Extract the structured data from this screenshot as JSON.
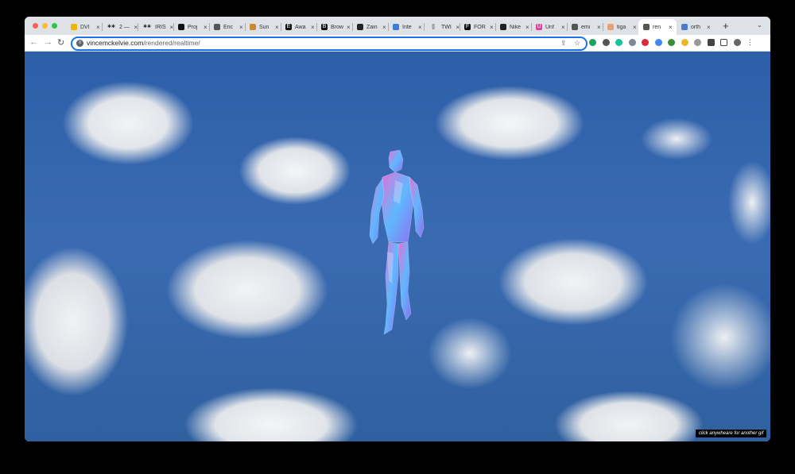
{
  "tabs": [
    {
      "title": "DVI",
      "icon": "yellow-badge-icon",
      "color": "#f2b400",
      "glyph": ""
    },
    {
      "title": "2 —",
      "icon": "dots-icon",
      "color": "#333333",
      "glyph": "✱✱"
    },
    {
      "title": "IRIS",
      "icon": "dots-icon",
      "color": "#333333",
      "glyph": "✱✱"
    },
    {
      "title": "Proj",
      "icon": "black-circle-icon",
      "color": "#111111",
      "glyph": ""
    },
    {
      "title": "Eric",
      "icon": "globe-icon",
      "color": "#555555",
      "glyph": ""
    },
    {
      "title": "Sun",
      "icon": "chair-icon",
      "color": "#c98a2b",
      "glyph": ""
    },
    {
      "title": "Awa",
      "icon": "e-square-icon",
      "color": "#111111",
      "glyph": "E"
    },
    {
      "title": "Brow",
      "icon": "b-square-icon",
      "color": "#111111",
      "glyph": "B"
    },
    {
      "title": "Zain",
      "icon": "pin-icon",
      "color": "#222222",
      "glyph": ""
    },
    {
      "title": "Inte",
      "icon": "globe-color-icon",
      "color": "#3b7dd8",
      "glyph": ""
    },
    {
      "title": "TWI",
      "icon": "bracket-icon",
      "color": "#222222",
      "glyph": "[]"
    },
    {
      "title": "FOR",
      "icon": "f-icon",
      "color": "#111111",
      "glyph": "F"
    },
    {
      "title": "Nike",
      "icon": "pin-icon",
      "color": "#222222",
      "glyph": ""
    },
    {
      "title": "Unf",
      "icon": "um-icon",
      "color": "#e0409b",
      "glyph": "U"
    },
    {
      "title": "emi",
      "icon": "globe-icon",
      "color": "#555555",
      "glyph": ""
    },
    {
      "title": "tiga",
      "icon": "hand-icon",
      "color": "#e8a070",
      "glyph": ""
    },
    {
      "title": "ren",
      "icon": "globe-icon",
      "color": "#555555",
      "glyph": "",
      "active": true
    },
    {
      "title": "orth",
      "icon": "pen-icon",
      "color": "#4a7bd0",
      "glyph": ""
    }
  ],
  "address": {
    "host": "vincemckelvie.com",
    "path": "/rendered/realtime/"
  },
  "extensions": [
    {
      "icon": "share-icon"
    },
    {
      "icon": "star-icon"
    },
    {
      "icon": "bolt-icon",
      "color": "#1aa260"
    },
    {
      "icon": "owl-icon",
      "color": "#555555"
    },
    {
      "icon": "grammarly-icon",
      "color": "#15c39a"
    },
    {
      "icon": "shield-icon",
      "color": "#7a8a9a"
    },
    {
      "icon": "abp-icon",
      "color": "#e0263a"
    },
    {
      "icon": "translate-icon",
      "color": "#4285f4"
    },
    {
      "icon": "download-icon",
      "color": "#3c8c3c"
    },
    {
      "icon": "color-picker-icon",
      "color": "#f0b429"
    },
    {
      "icon": "feather-icon",
      "color": "#999999"
    },
    {
      "icon": "puzzle-icon",
      "color": "#444444"
    },
    {
      "icon": "sidebar-icon",
      "color": "#444444"
    },
    {
      "icon": "avatar-icon",
      "color": "#666666"
    },
    {
      "icon": "menu-icon",
      "color": "#444444"
    }
  ],
  "page": {
    "caption": "click anywheare for another gif"
  },
  "colors": {
    "figure_pink": "#e96fd6",
    "figure_blue": "#5fb8ff",
    "figure_violet": "#8f6ff0",
    "focus_ring": "#1a73e8"
  }
}
